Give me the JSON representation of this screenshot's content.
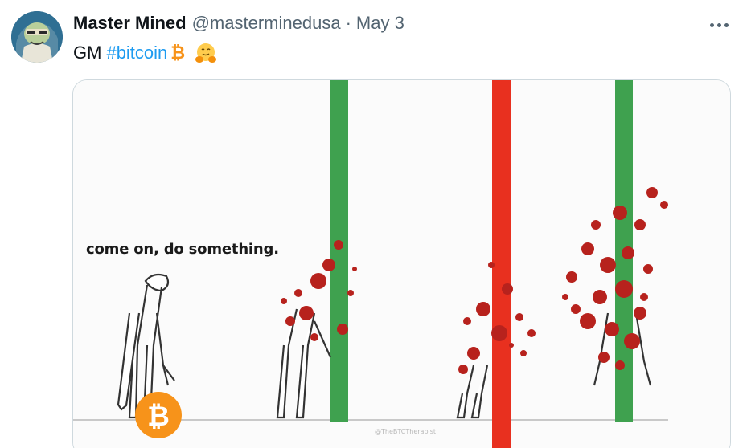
{
  "tweet": {
    "display_name": "Master Mined",
    "handle": "@masterminedusa",
    "separator": "·",
    "date": "May 3",
    "text_prefix": "GM",
    "hashtag": "#bitcoin",
    "btc_symbol": "₿",
    "emoji_name": "hugging-face-icon"
  },
  "media": {
    "caption": "come on, do something.",
    "watermark": "@TheBTCTherapist",
    "coin_symbol": "₿",
    "colors": {
      "green_candle": "#3fa14f",
      "red_candle": "#e8301f",
      "blood": "#b7221d",
      "coin": "#f7931a"
    }
  },
  "icons": [
    "more-icon",
    "avatar"
  ]
}
